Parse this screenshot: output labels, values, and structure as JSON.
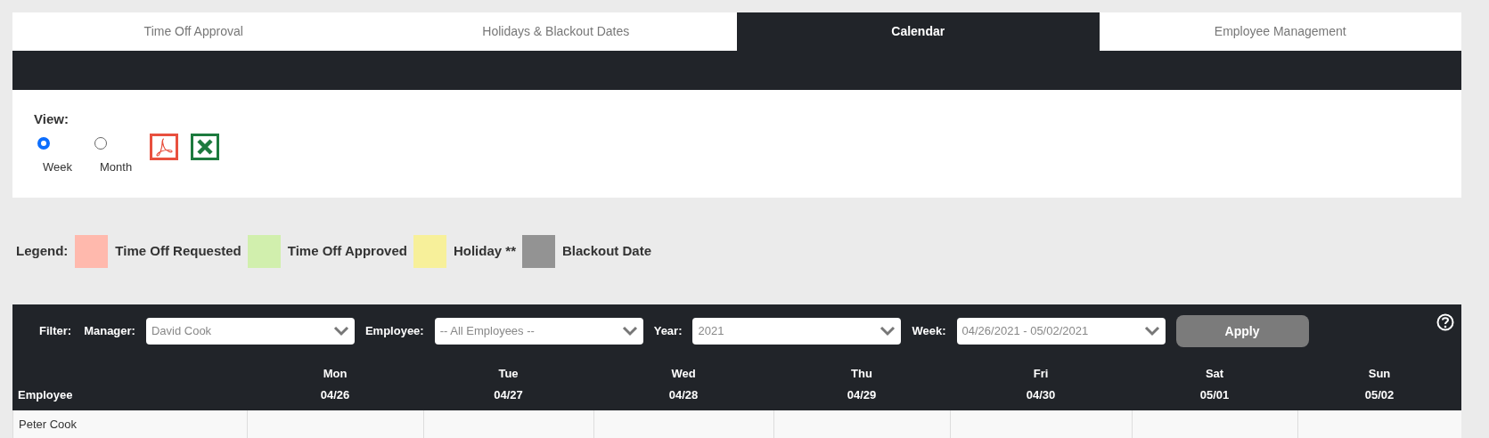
{
  "tabs": [
    {
      "label": "Time Off Approval",
      "selected": false
    },
    {
      "label": "Holidays & Blackout Dates",
      "selected": false
    },
    {
      "label": "Calendar",
      "selected": true
    },
    {
      "label": "Employee Management",
      "selected": false
    }
  ],
  "view": {
    "label": "View:",
    "options": [
      {
        "label": "Week",
        "selected": true
      },
      {
        "label": "Month",
        "selected": false
      }
    ]
  },
  "legend": {
    "label": "Legend:",
    "items": [
      {
        "label": "Time Off Requested",
        "color": "#ffb9ad"
      },
      {
        "label": "Time Off Approved",
        "color": "#d1efad"
      },
      {
        "label": "Holiday **",
        "color": "#f7f09a"
      },
      {
        "label": "Blackout Date",
        "color": "#939393"
      }
    ]
  },
  "filter": {
    "label": "Filter:",
    "fields": [
      {
        "label": "Manager:",
        "value": "David Cook"
      },
      {
        "label": "Employee:",
        "value": "-- All Employees --"
      },
      {
        "label": "Year:",
        "value": "2021"
      },
      {
        "label": "Week:",
        "value": "04/26/2021 - 05/02/2021"
      }
    ],
    "apply": "Apply"
  },
  "table": {
    "employee_header": "Employee",
    "days": [
      {
        "day": "Mon",
        "date": "04/26"
      },
      {
        "day": "Tue",
        "date": "04/27"
      },
      {
        "day": "Wed",
        "date": "04/28"
      },
      {
        "day": "Thu",
        "date": "04/29"
      },
      {
        "day": "Fri",
        "date": "04/30"
      },
      {
        "day": "Sat",
        "date": "05/01"
      },
      {
        "day": "Sun",
        "date": "05/02"
      }
    ],
    "rows": [
      {
        "employee": "Peter Cook"
      }
    ]
  }
}
